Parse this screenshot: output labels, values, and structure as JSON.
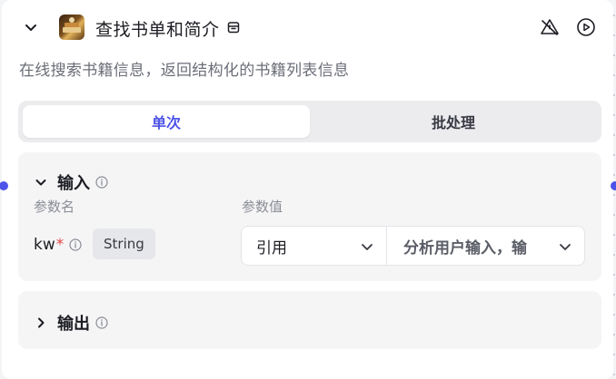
{
  "node": {
    "title": "查找书单和简介",
    "description": "在线搜索书籍信息，返回结构化的书籍列表信息"
  },
  "tabs": [
    {
      "label": "单次",
      "active": true
    },
    {
      "label": "批处理",
      "active": false
    }
  ],
  "input_section": {
    "title": "输入",
    "col_name": "参数名",
    "col_value": "参数值",
    "params": [
      {
        "name": "kw",
        "required_mark": "*",
        "type": "String",
        "source": "引用",
        "value": "分析用户输入，输"
      }
    ]
  },
  "output_section": {
    "title": "输出"
  },
  "colors": {
    "accent": "#4d53e8",
    "required": "#e54545"
  },
  "icons": [
    "chevron-down-icon",
    "book-thumbnail-icon",
    "store-icon",
    "warning-muted-icon",
    "play-icon",
    "info-icon",
    "chevron-right-icon"
  ]
}
